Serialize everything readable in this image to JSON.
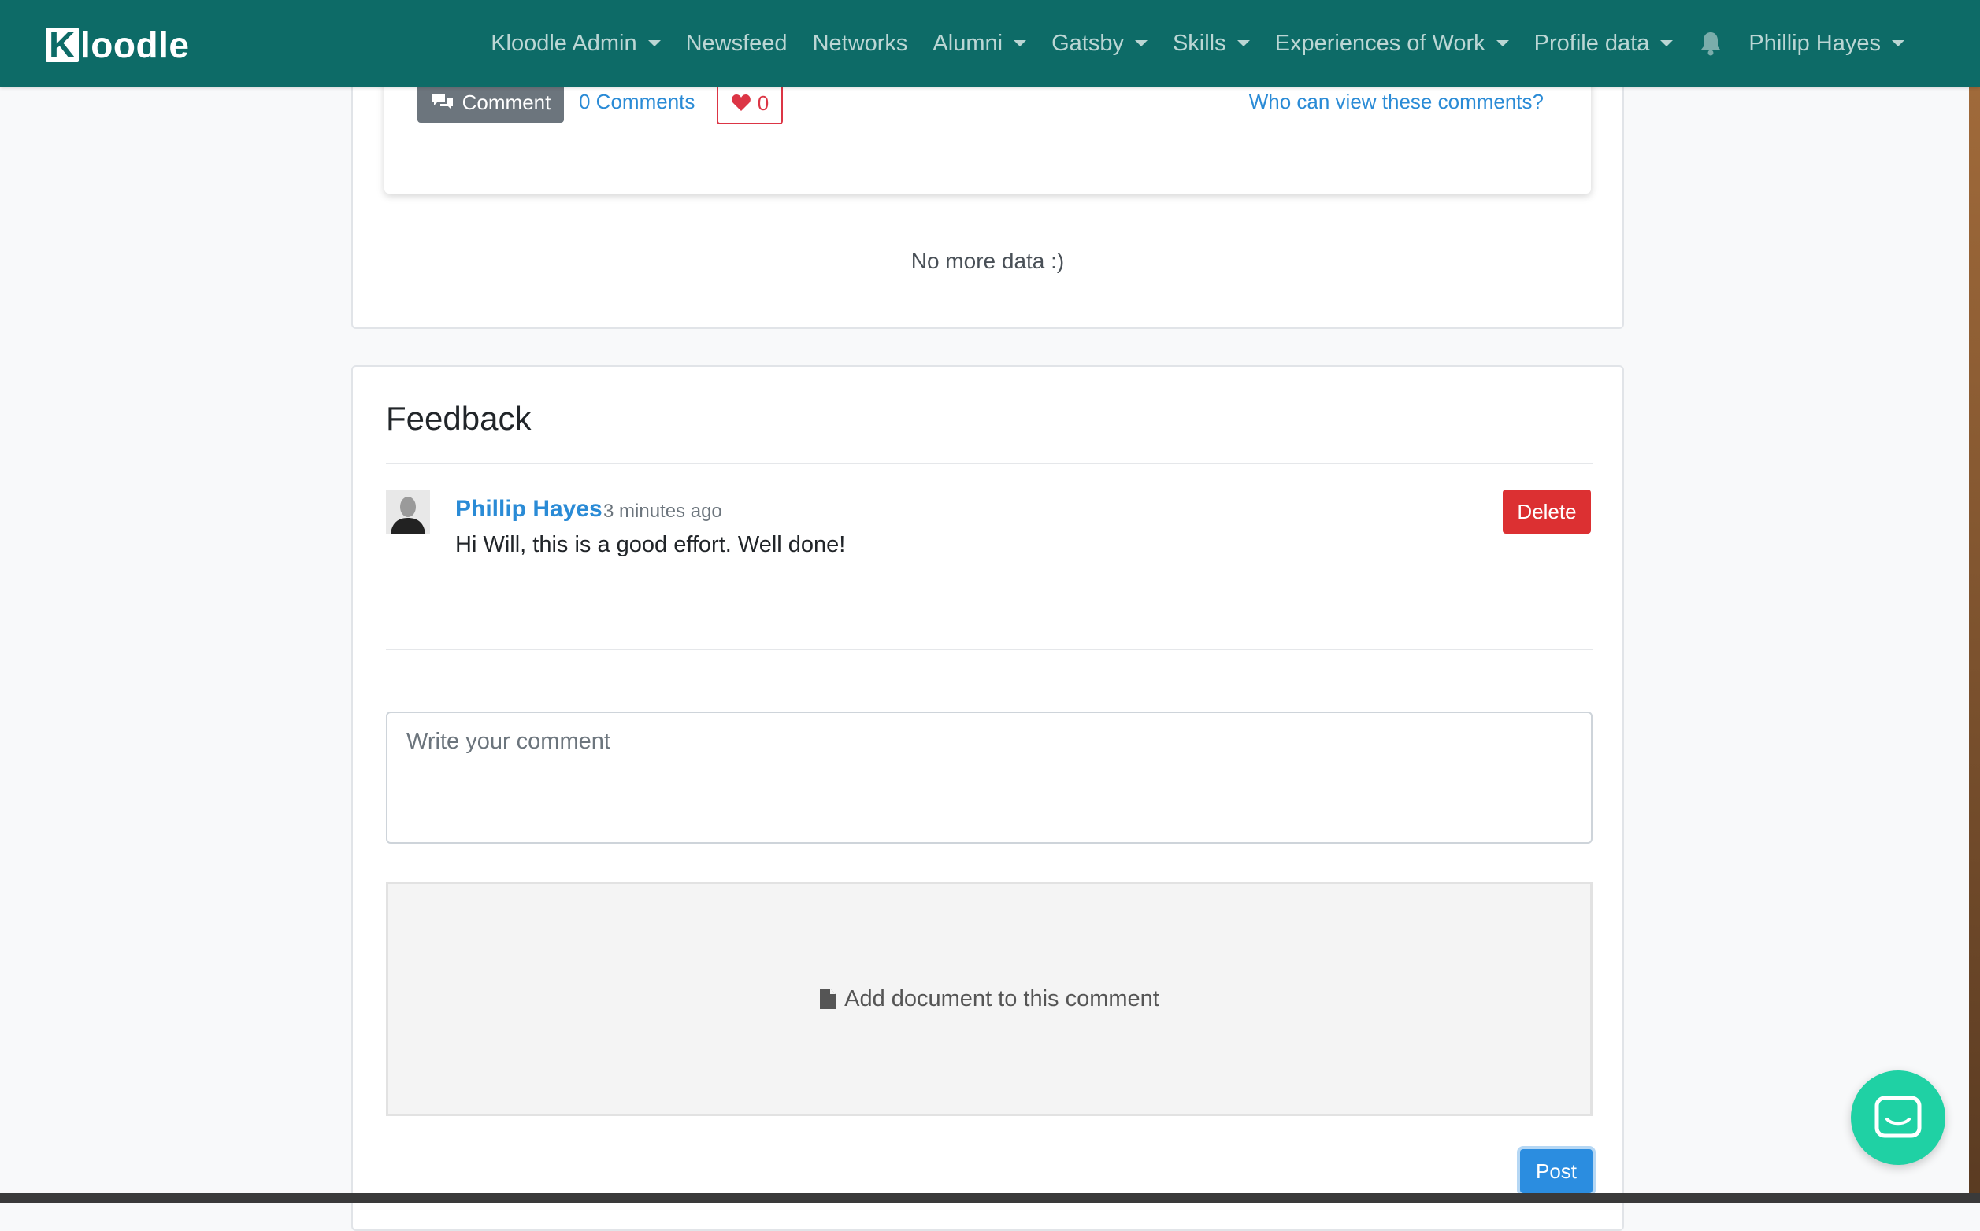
{
  "navbar": {
    "brand_k": "K",
    "brand_rest": "loodle",
    "items": [
      {
        "label": "Kloodle Admin",
        "dropdown": true
      },
      {
        "label": "Newsfeed",
        "dropdown": false
      },
      {
        "label": "Networks",
        "dropdown": false
      },
      {
        "label": "Alumni",
        "dropdown": true
      },
      {
        "label": "Gatsby",
        "dropdown": true
      },
      {
        "label": "Skills",
        "dropdown": true
      },
      {
        "label": "Experiences of Work",
        "dropdown": true
      },
      {
        "label": "Profile data",
        "dropdown": true
      }
    ],
    "notification_icon": "bell-icon",
    "user_name": "Phillip Hayes"
  },
  "post": {
    "comment_button": "Comment",
    "comments_count": "0 Comments",
    "likes": "0",
    "who_can_view": "Who can view these comments?"
  },
  "feed_end": "No more data :)",
  "feedback": {
    "title": "Feedback",
    "comment": {
      "author": "Phillip Hayes",
      "time": "3 minutes ago",
      "text": "Hi Will, this is a good effort. Well done!",
      "delete_label": "Delete"
    },
    "input_placeholder": "Write your comment",
    "attach_label": "Add document to this comment",
    "post_label": "Post"
  },
  "colors": {
    "navbar": "#0d6b67",
    "link": "#2a8bd6",
    "danger": "#dc3032",
    "primary": "#2b8de0",
    "chat": "#1fd1a4"
  }
}
